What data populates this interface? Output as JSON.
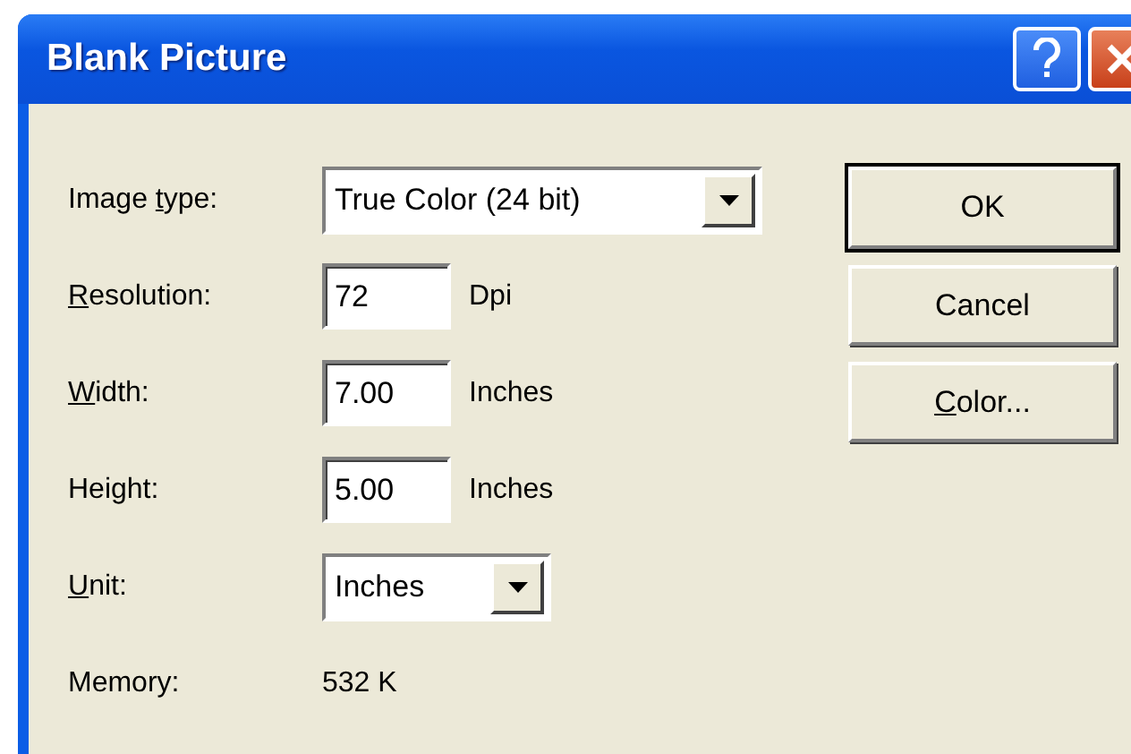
{
  "window": {
    "title": "Blank Picture"
  },
  "fields": [
    {
      "kind": "combo",
      "label": {
        "before": "Image ",
        "key": "t",
        "after": "ype:"
      },
      "value": "True Color (24 bit)"
    },
    {
      "kind": "text",
      "label": {
        "key": "R",
        "after": "esolution:"
      },
      "value": "72",
      "unit": "Dpi"
    },
    {
      "kind": "text",
      "label": {
        "key": "W",
        "after": "idth:"
      },
      "value": "7.00",
      "unit": "Inches"
    },
    {
      "kind": "text",
      "label": {
        "before": "Height:"
      },
      "value": "5.00",
      "unit": "Inches"
    },
    {
      "kind": "combo",
      "label": {
        "key": "U",
        "after": "nit:"
      },
      "value": "Inches"
    },
    {
      "kind": "info",
      "label": {
        "before": "Memory:"
      },
      "value": "532 K"
    }
  ],
  "buttons": [
    {
      "label": {
        "before": "OK"
      },
      "default": true
    },
    {
      "label": {
        "before": "Cancel"
      },
      "default": false
    },
    {
      "label": {
        "key": "C",
        "after": "olor..."
      },
      "default": false
    }
  ]
}
